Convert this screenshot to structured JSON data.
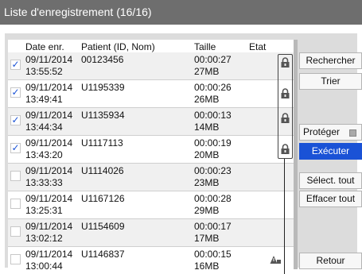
{
  "title": "Liste d'enregistrement  (16/16)",
  "columns": {
    "date": "Date enr.",
    "patient": "Patient (ID, Nom)",
    "size": "Taille",
    "state": "Etat"
  },
  "rows": [
    {
      "checked": "✓",
      "date": "09/11/2014",
      "time": "13:55:52",
      "patient": "00123456",
      "duration": "00:00:27",
      "size": "27MB",
      "state_icon": "lock-icon"
    },
    {
      "checked": "✓",
      "date": "09/11/2014",
      "time": "13:49:41",
      "patient": "U1195339",
      "duration": "00:00:26",
      "size": "26MB",
      "state_icon": "lock-icon"
    },
    {
      "checked": "✓",
      "date": "09/11/2014",
      "time": "13:44:34",
      "patient": "U1135934",
      "duration": "00:00:13",
      "size": "14MB",
      "state_icon": "lock-icon"
    },
    {
      "checked": "✓",
      "date": "09/11/2014",
      "time": "13:43:20",
      "patient": "U1117113",
      "duration": "00:00:19",
      "size": "20MB",
      "state_icon": "lock-icon"
    },
    {
      "checked": "",
      "date": "09/11/2014",
      "time": "13:33:33",
      "patient": "U1114026",
      "duration": "00:00:23",
      "size": "23MB",
      "state_icon": ""
    },
    {
      "checked": "",
      "date": "09/11/2014",
      "time": "13:25:31",
      "patient": "U1167126",
      "duration": "00:00:28",
      "size": "29MB",
      "state_icon": ""
    },
    {
      "checked": "",
      "date": "09/11/2014",
      "time": "13:02:12",
      "patient": "U1154609",
      "duration": "00:00:17",
      "size": "17MB",
      "state_icon": ""
    },
    {
      "checked": "",
      "date": "09/11/2014",
      "time": "13:00:44",
      "patient": "U1146837",
      "duration": "00:00:15",
      "size": "16MB",
      "state_icon": "warning-icon"
    }
  ],
  "buttons": {
    "search": "Rechercher",
    "sort": "Trier",
    "protect": "Protéger",
    "execute": "Exécuter",
    "select_all": "Sélect. tout",
    "clear_all": "Effacer tout",
    "back": "Retour"
  },
  "colors": {
    "accent": "#1a52d6",
    "titlebar": "#6e6e6e"
  }
}
